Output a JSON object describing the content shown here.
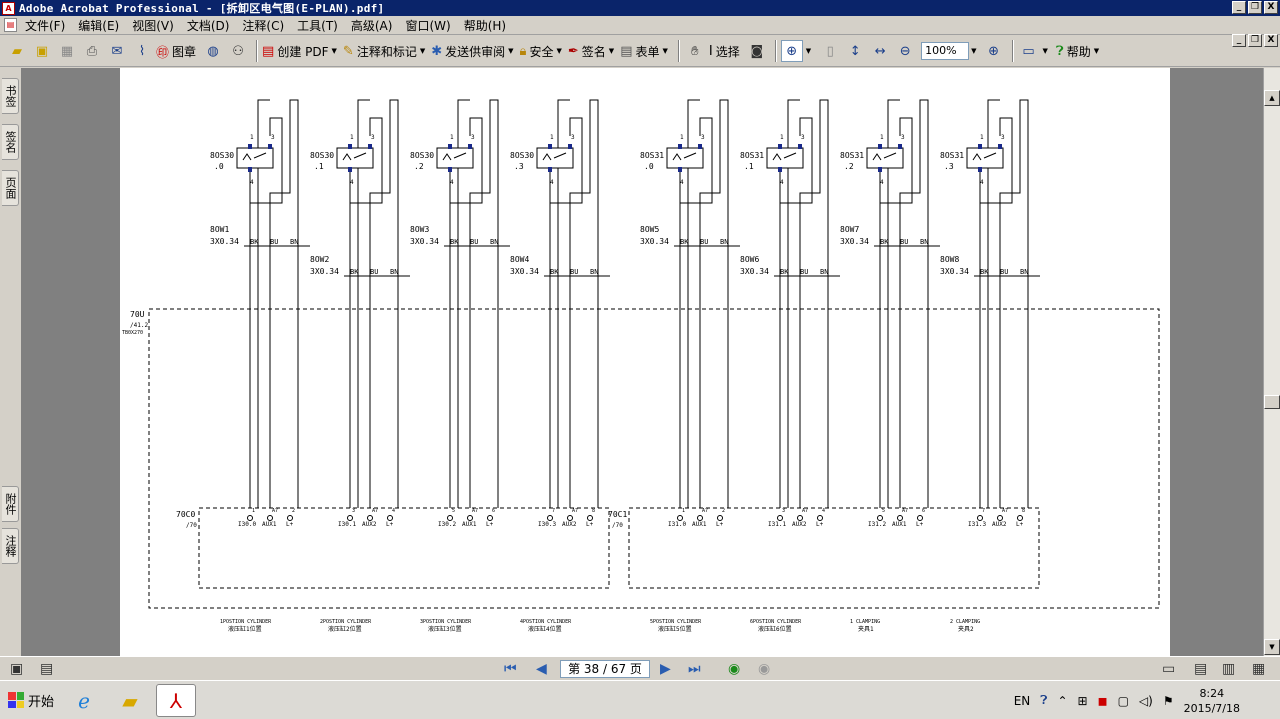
{
  "window": {
    "title": "Adobe Acrobat Professional - [拆卸区电气图(E-PLAN).pdf]",
    "app_icon_text": "A",
    "minimize": "_",
    "restore": "❐",
    "close": "X"
  },
  "menu": {
    "items": [
      "文件(F)",
      "编辑(E)",
      "视图(V)",
      "文档(D)",
      "注释(C)",
      "工具(T)",
      "高级(A)",
      "窗口(W)",
      "帮助(H)"
    ]
  },
  "toolbar": {
    "stamp": "图章",
    "create_pdf": "创建 PDF",
    "comment": "注释和标记",
    "review": "发送供审阅",
    "secure": "安全",
    "sign": "签名",
    "forms": "表单",
    "select": "选择",
    "zoom": "100%",
    "help": "帮助"
  },
  "sidetabs": [
    "书签",
    "签名",
    "页面",
    "附件",
    "注释"
  ],
  "schematic": {
    "switches": [
      {
        "tag": "8OS30",
        "idx": ".0",
        "cable": "8OW1",
        "terminal": "I30.0",
        "aux": "AUX1",
        "pin": "1",
        "caption1": "1POSTION CYLINDER",
        "caption2": "液压缸1位置"
      },
      {
        "tag": "8OS30",
        "idx": ".1",
        "cable": "8OW2",
        "terminal": "I30.1",
        "aux": "AUX2",
        "pin": "3",
        "caption1": "2POSTION CYLINDER",
        "caption2": "液压缸2位置"
      },
      {
        "tag": "8OS30",
        "idx": ".2",
        "cable": "8OW3",
        "terminal": "I30.2",
        "aux": "AUX1",
        "pin": "5",
        "caption1": "3POSTION CYLINDER",
        "caption2": "液压缸3位置"
      },
      {
        "tag": "8OS30",
        "idx": ".3",
        "cable": "8OW4",
        "terminal": "I30.3",
        "aux": "AUX2",
        "pin": "7",
        "caption1": "4POSTION CYLINDER",
        "caption2": "液压缸4位置"
      },
      {
        "tag": "8OS31",
        "idx": ".0",
        "cable": "8OW5",
        "terminal": "I31.0",
        "aux": "AUX1",
        "pin": "1",
        "caption1": "5POSTION CYLINDER",
        "caption2": "液压缸5位置"
      },
      {
        "tag": "8OS31",
        "idx": ".1",
        "cable": "8OW6",
        "terminal": "I31.1",
        "aux": "AUX2",
        "pin": "3",
        "caption1": "6POSTION CYLINDER",
        "caption2": "液压缸6位置"
      },
      {
        "tag": "8OS31",
        "idx": ".2",
        "cable": "8OW7",
        "terminal": "I31.2",
        "aux": "AUX1",
        "pin": "5",
        "caption1": "1 CLAMPING",
        "caption2": "夹具1"
      },
      {
        "tag": "8OS31",
        "idx": ".3",
        "cable": "8OW8",
        "terminal": "I31.3",
        "aux": "AUX2",
        "pin": "7",
        "caption1": "2 CLAMPING",
        "caption2": "夹具2"
      }
    ],
    "cable_spec": "3X0.34",
    "wire_colors": [
      "BK",
      "BU",
      "BN"
    ],
    "switch_pins": [
      "1",
      "3",
      "4"
    ],
    "box_main": {
      "tag": "70U",
      "ref1": "/41.2",
      "ref2": "TB0X270"
    },
    "box_left": {
      "tag": "70C0",
      "ref": "/70"
    },
    "box_right": {
      "tag": "70C1",
      "ref": "/70"
    },
    "terminal_plus": "L+",
    "terminal_a": "A7"
  },
  "nav": {
    "page_display": "第 38 / 67 页"
  },
  "taskbar": {
    "start": "开始",
    "lang": "EN",
    "time": "8:24",
    "date": "2015/7/18"
  }
}
